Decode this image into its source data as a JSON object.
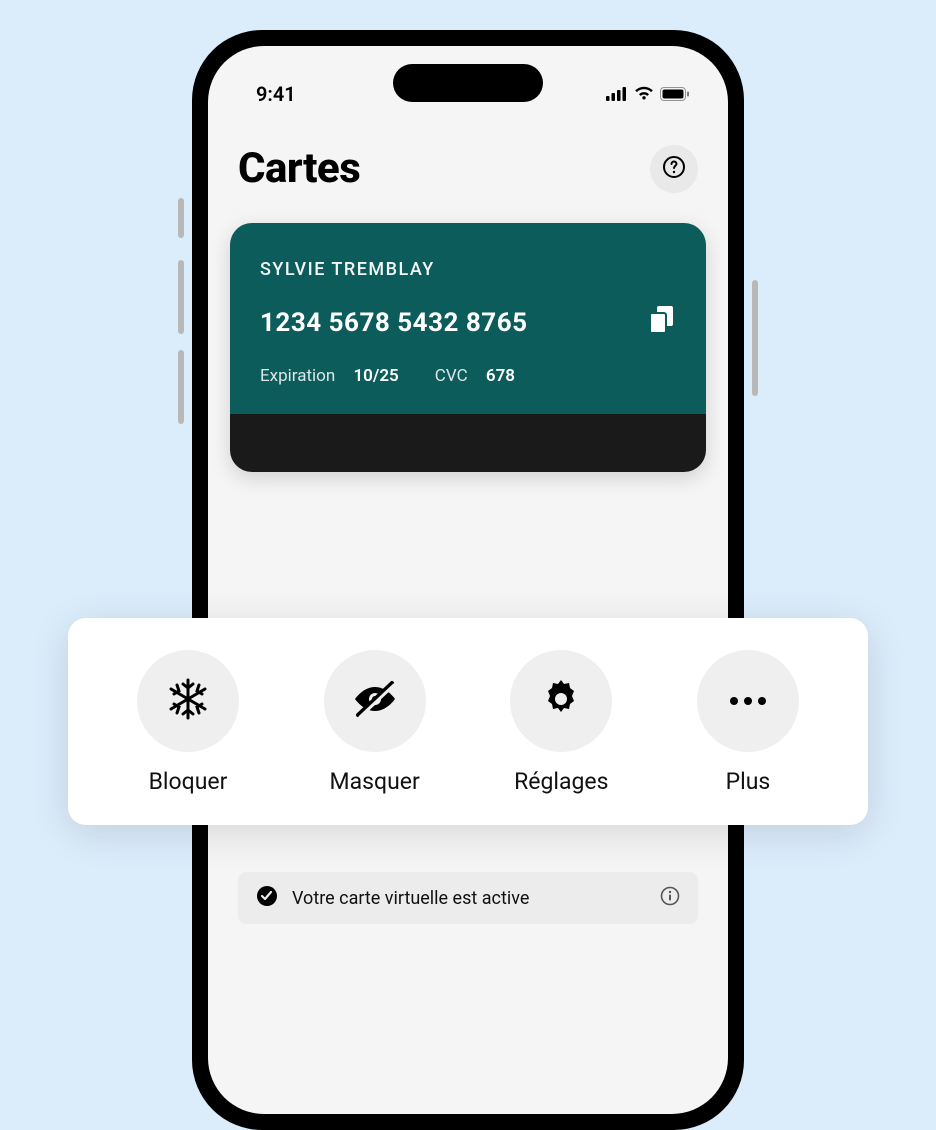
{
  "status_bar": {
    "time": "9:41"
  },
  "header": {
    "title": "Cartes"
  },
  "card": {
    "holder_name": "SYLVIE TREMBLAY",
    "number": "1234 5678 5432 8765",
    "expiration_label": "Expiration",
    "expiration_value": "10/25",
    "cvc_label": "CVC",
    "cvc_value": "678"
  },
  "actions": {
    "block": "Bloquer",
    "mask": "Masquer",
    "settings": "Réglages",
    "more": "Plus"
  },
  "status": {
    "text": "Votre carte virtuelle est active"
  }
}
